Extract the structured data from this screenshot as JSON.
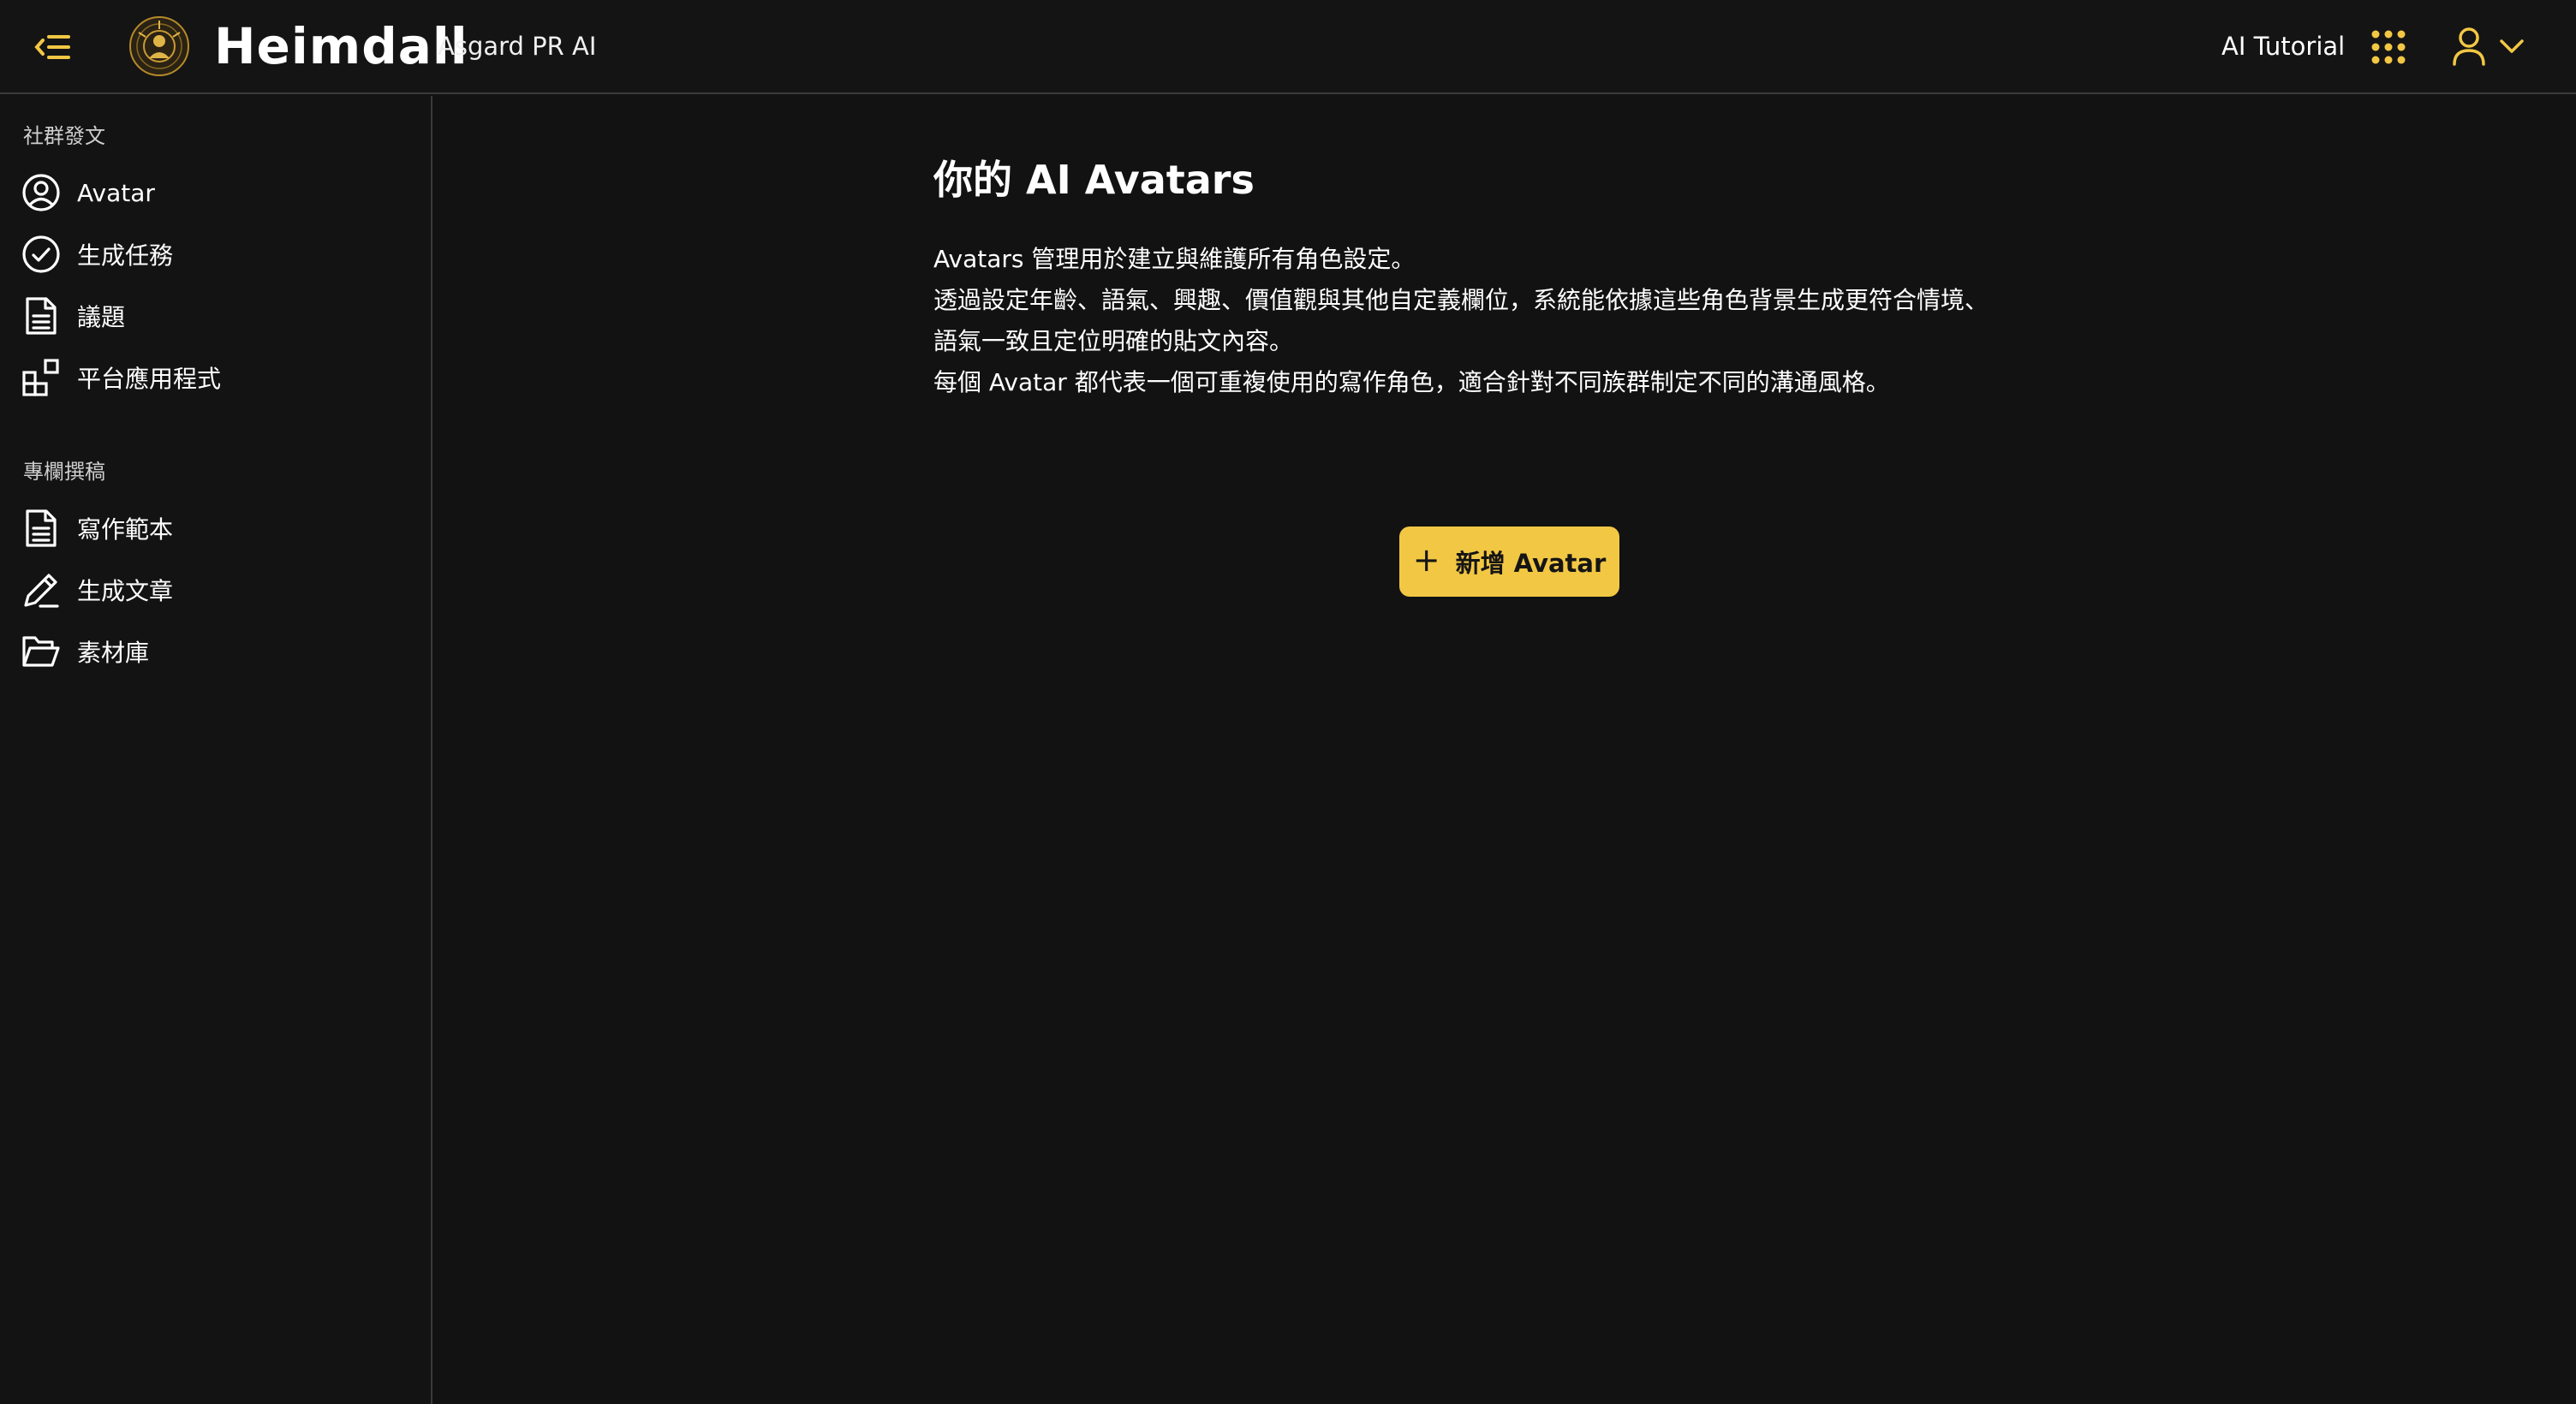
{
  "colors": {
    "accent": "#f2c744",
    "background": "#121212",
    "border": "#3a3a3a",
    "text": "#ffffff"
  },
  "header": {
    "brand": "Heimdall",
    "brand_sub": "Asgard PR AI",
    "tutorial_label": "AI Tutorial",
    "icons": {
      "collapse": "collapse-sidebar-icon",
      "logo": "heimdall-logo",
      "apps": "apps-grid-icon",
      "user": "user-icon",
      "chevron": "chevron-down-icon"
    }
  },
  "sidebar": {
    "sections": [
      {
        "label": "社群發文",
        "items": [
          {
            "label": "Avatar",
            "icon": "user-circle-icon"
          },
          {
            "label": "生成任務",
            "icon": "check-circle-icon"
          },
          {
            "label": "議題",
            "icon": "document-icon"
          },
          {
            "label": "平台應用程式",
            "icon": "apps-icon"
          }
        ]
      },
      {
        "label": "專欄撰稿",
        "items": [
          {
            "label": "寫作範本",
            "icon": "document-icon"
          },
          {
            "label": "生成文章",
            "icon": "pencil-icon"
          },
          {
            "label": "素材庫",
            "icon": "folder-open-icon"
          }
        ]
      }
    ]
  },
  "main": {
    "title": "你的 AI Avatars",
    "description": [
      "Avatars 管理用於建立與維護所有角色設定。",
      "透過設定年齡、語氣、興趣、價值觀與其他自定義欄位，系統能依據這些角色背景生成更符合情境、",
      "語氣一致且定位明確的貼文內容。",
      "每個 Avatar 都代表一個可重複使用的寫作角色，適合針對不同族群制定不同的溝通風格。"
    ],
    "add_button": {
      "icon": "+",
      "label": "新增 Avatar"
    }
  }
}
